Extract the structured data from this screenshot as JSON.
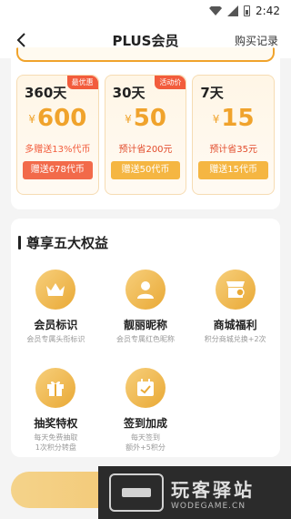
{
  "status": {
    "time": "2:42"
  },
  "nav": {
    "title": "PLUS会员",
    "records": "购买记录",
    "back_icon": "chevron-left-icon"
  },
  "plans": [
    {
      "days": "360天",
      "badge": "最优惠",
      "yen": "¥",
      "price": "600",
      "desc": "多赠送13%代币",
      "bonus": "赠送678代币"
    },
    {
      "days": "30天",
      "badge": "活动价",
      "yen": "¥",
      "price": "50",
      "desc": "预计省200元",
      "bonus": "赠送50代币"
    },
    {
      "days": "7天",
      "badge": "",
      "yen": "¥",
      "price": "15",
      "desc": "预计省35元",
      "bonus": "赠送15代币"
    }
  ],
  "benefits": {
    "title": "尊享五大权益",
    "items": [
      {
        "name": "会员标识",
        "sub": "会员专属头衔标识",
        "icon": "crown-icon"
      },
      {
        "name": "靓丽昵称",
        "sub": "会员专属红色昵称",
        "icon": "user-icon"
      },
      {
        "name": "商城福利",
        "sub": "积分商城兑换+2次",
        "icon": "shop-icon"
      },
      {
        "name": "抽奖特权",
        "sub": "每天免费抽取\n1次积分转盘",
        "icon": "gift-icon"
      },
      {
        "name": "签到加成",
        "sub": "每天签到\n额外+5积分",
        "icon": "calendar-check-icon"
      }
    ]
  },
  "watermark": {
    "main": "玩客驿站",
    "sub": "WODEGAME.CN"
  },
  "colors": {
    "accent": "#f0a32c",
    "red": "#f25c3c"
  }
}
